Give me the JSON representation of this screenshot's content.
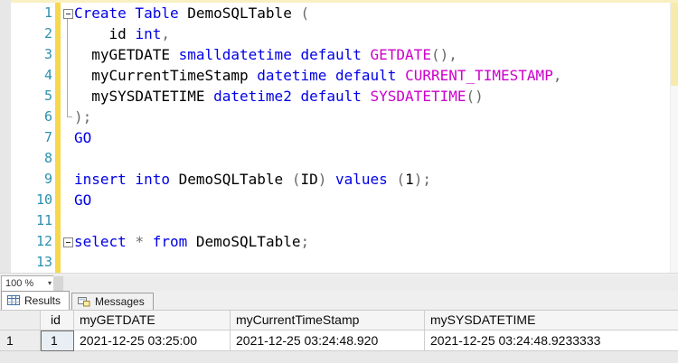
{
  "editor": {
    "zoom_level": "100 %",
    "zoom_dropdown_glyph": "▾",
    "lines": [
      {
        "n": 1,
        "fold": true,
        "tokens": [
          [
            "kw",
            "Create Table"
          ],
          [
            "id",
            " DemoSQLTable "
          ],
          [
            "op",
            "("
          ]
        ]
      },
      {
        "n": 2,
        "fold": false,
        "tokens": [
          [
            "id",
            "    id "
          ],
          [
            "kw",
            "int"
          ],
          [
            "op",
            ","
          ]
        ]
      },
      {
        "n": 3,
        "fold": false,
        "tokens": [
          [
            "id",
            "  myGETDATE "
          ],
          [
            "kw",
            "smalldatetime default "
          ],
          [
            "fn",
            "GETDATE"
          ],
          [
            "op",
            "(),"
          ]
        ]
      },
      {
        "n": 4,
        "fold": false,
        "tokens": [
          [
            "id",
            "  myCurrentTimeStamp "
          ],
          [
            "kw",
            "datetime default "
          ],
          [
            "fn",
            "CURRENT_TIMESTAMP"
          ],
          [
            "op",
            ","
          ]
        ]
      },
      {
        "n": 5,
        "fold": false,
        "tokens": [
          [
            "id",
            "  mySYSDATETIME "
          ],
          [
            "kw",
            "datetime2 default "
          ],
          [
            "fn",
            "SYSDATETIME"
          ],
          [
            "op",
            "()"
          ]
        ]
      },
      {
        "n": 6,
        "fold": false,
        "tokens": [
          [
            "op",
            ");"
          ]
        ]
      },
      {
        "n": 7,
        "fold": false,
        "tokens": [
          [
            "kw",
            "GO"
          ]
        ]
      },
      {
        "n": 8,
        "fold": false,
        "tokens": []
      },
      {
        "n": 9,
        "fold": false,
        "tokens": [
          [
            "kw",
            "insert into "
          ],
          [
            "id",
            "DemoSQLTable "
          ],
          [
            "op",
            "("
          ],
          [
            "id",
            "ID"
          ],
          [
            "op",
            ") "
          ],
          [
            "kw",
            "values "
          ],
          [
            "op",
            "("
          ],
          [
            "id",
            "1"
          ],
          [
            "op",
            ");"
          ]
        ]
      },
      {
        "n": 10,
        "fold": false,
        "tokens": [
          [
            "kw",
            "GO"
          ]
        ]
      },
      {
        "n": 11,
        "fold": false,
        "tokens": []
      },
      {
        "n": 12,
        "fold": true,
        "tokens": [
          [
            "kw",
            "select "
          ],
          [
            "op",
            "* "
          ],
          [
            "kw",
            "from "
          ],
          [
            "id",
            "DemoSQLTable"
          ],
          [
            "op",
            ";"
          ]
        ]
      },
      {
        "n": 13,
        "fold": false,
        "tokens": []
      }
    ]
  },
  "colors": {
    "keyword": "#0000E6",
    "identifier": "#000000",
    "system_function": "#CC00CC",
    "operator": "#696969",
    "line_number": "#2B91AF",
    "change_tracking_bar": "#F7D74C"
  },
  "results_panel": {
    "tabs": [
      {
        "label": "Results",
        "icon": "results-grid-icon",
        "active": true
      },
      {
        "label": "Messages",
        "icon": "messages-icon",
        "active": false
      }
    ],
    "grid": {
      "columns": [
        "id",
        "myGETDATE",
        "myCurrentTimeStamp",
        "mySYSDATETIME"
      ],
      "rows": [
        {
          "row_header": "1",
          "cells": [
            "1",
            "2021-12-25 03:25:00",
            "2021-12-25 03:24:48.920",
            "2021-12-25 03:24:48.9233333"
          ]
        }
      ],
      "selected_cell": {
        "row": 0,
        "col": 0
      }
    }
  }
}
